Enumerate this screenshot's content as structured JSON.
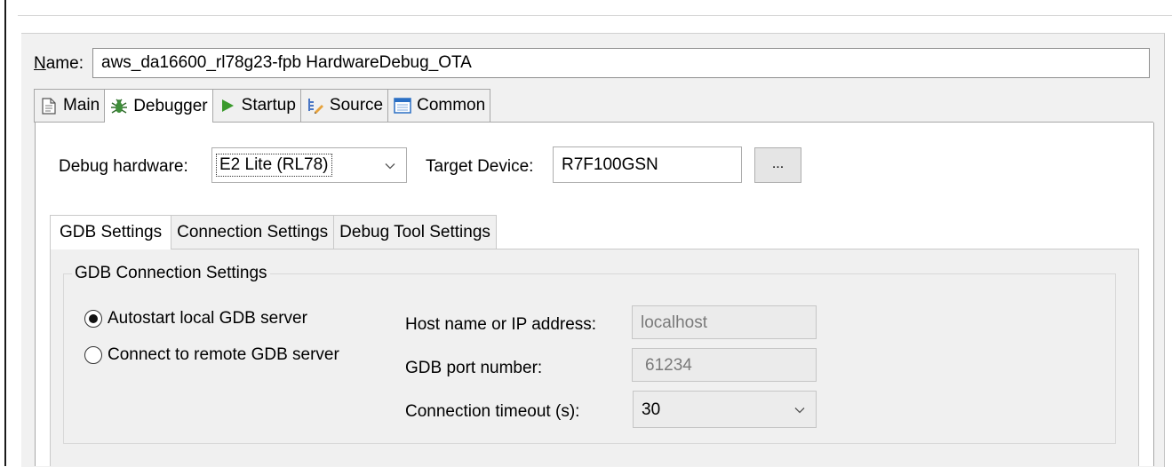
{
  "dialog": {
    "name_label_prefix": "",
    "name_label_mnemonic": "N",
    "name_label_rest": "ame:",
    "name_value": "aws_da16600_rl78g23-fpb HardwareDebug_OTA"
  },
  "top_tabs": [
    {
      "label": "Main",
      "icon": "document-icon"
    },
    {
      "label": "Debugger",
      "icon": "bug-icon",
      "active": true
    },
    {
      "label": "Startup",
      "icon": "play-icon"
    },
    {
      "label": "Source",
      "icon": "source-icon"
    },
    {
      "label": "Common",
      "icon": "window-icon"
    }
  ],
  "debugger": {
    "debug_hardware_label": "Debug hardware:",
    "debug_hardware_value": "E2 Lite (RL78)",
    "target_device_label": "Target Device:",
    "target_device_value": "R7F100GSN",
    "browse_label": "..."
  },
  "inner_tabs": [
    {
      "label": "GDB Settings",
      "active": true
    },
    {
      "label": "Connection Settings"
    },
    {
      "label": "Debug Tool Settings"
    }
  ],
  "gdb": {
    "group_title": "GDB Connection Settings",
    "radio_autostart": "Autostart local GDB server",
    "radio_remote": "Connect to remote GDB server",
    "selected": "autostart",
    "host_label": "Host name or IP address:",
    "host_value": "localhost",
    "port_label": "GDB port number:",
    "port_value": "61234",
    "timeout_label": "Connection timeout (s):",
    "timeout_value": "30"
  },
  "colors": {
    "debugger_icon": "#2e7d32",
    "startup_icon": "#3a9a2c",
    "common_icon": "#2a6fc4"
  }
}
